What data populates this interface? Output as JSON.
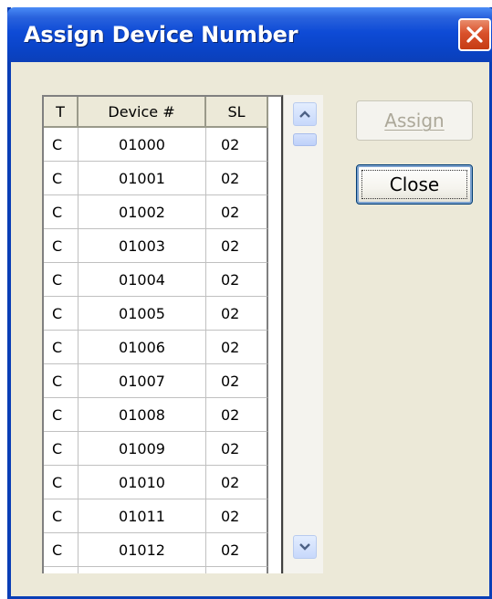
{
  "window": {
    "title": "Assign Device Number"
  },
  "grid": {
    "headers": [
      "T",
      "Device #",
      "SL"
    ],
    "rows": [
      [
        "C",
        "01000",
        "02"
      ],
      [
        "C",
        "01001",
        "02"
      ],
      [
        "C",
        "01002",
        "02"
      ],
      [
        "C",
        "01003",
        "02"
      ],
      [
        "C",
        "01004",
        "02"
      ],
      [
        "C",
        "01005",
        "02"
      ],
      [
        "C",
        "01006",
        "02"
      ],
      [
        "C",
        "01007",
        "02"
      ],
      [
        "C",
        "01008",
        "02"
      ],
      [
        "C",
        "01009",
        "02"
      ],
      [
        "C",
        "01010",
        "02"
      ],
      [
        "C",
        "01011",
        "02"
      ],
      [
        "C",
        "01012",
        "02"
      ],
      [
        "",
        "",
        ""
      ]
    ]
  },
  "buttons": {
    "assign_label": "Assign",
    "assign_enabled": false,
    "close_label": "Close"
  },
  "icons": {
    "close": "close-x-icon",
    "scroll_up": "chevron-up-icon",
    "scroll_down": "chevron-down-icon"
  },
  "colors": {
    "titlebar": "#0A44C8",
    "dialog_bg": "#ECE9D8",
    "close_button": "#D9512B"
  }
}
